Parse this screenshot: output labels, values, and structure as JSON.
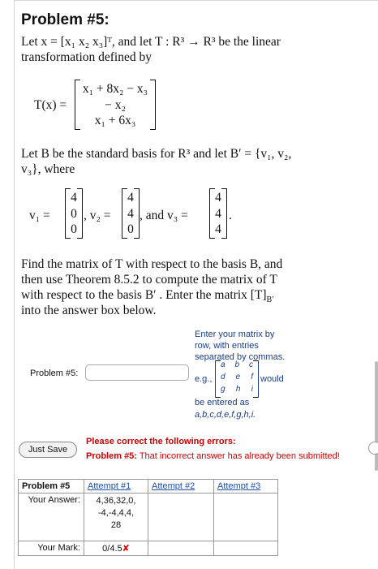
{
  "problem": {
    "title": "Problem #5:",
    "intro_a": "Let x = [x",
    "intro_text": "Let x = [x1 x2 x3]T, and let T: R3 → R3 be the linear transformation defined by",
    "line1": "Let x = [x₁  x₂  x₃]ᵀ, and let T : R³ → R³ be the linear",
    "line2": "transformation defined by",
    "tx_label": "T(x)  =",
    "tx_rows": [
      "x₁ + 8x₂ − x₃",
      "− x₂",
      "x₁ + 6x₃"
    ],
    "basis_line1": "Let B be the standard basis for R³ and let B′ = {v₁, v₂,",
    "basis_line2": "v₃}, where",
    "v1_label": "v₁  =",
    "v1": [
      "4",
      "0",
      "0"
    ],
    "v2_label": ",  v₂  =",
    "v2": [
      "4",
      "4",
      "0"
    ],
    "v3_label": ",  and  v₃  =",
    "v3": [
      "4",
      "4",
      "4"
    ],
    "find_lines": [
      "Find the matrix of T with respect to the basis B, and",
      "then use Theorem 8.5.2 to compute the matrix of T",
      "with respect to the basis B′ . Enter the matrix [T]",
      "into the answer box below."
    ],
    "sub_bprime": "B′"
  },
  "answer_area": {
    "label": "Problem #5:",
    "input_value": "",
    "hint_lines": [
      "Enter your matrix by",
      "row, with entries",
      "separated by commas."
    ],
    "eg_label": "e.g.,",
    "eg_matrix": [
      [
        "a",
        "b",
        "c"
      ],
      [
        "d",
        "e",
        "f"
      ],
      [
        "g",
        "h",
        "i"
      ]
    ],
    "would": "would",
    "be_entered": "be entered as",
    "example_entry": "a,b,c,d,e,f,g,h,i."
  },
  "actions": {
    "just_save": "Just Save"
  },
  "errors": {
    "heading": "Please correct the following errors:",
    "problem_label": "Problem #5:",
    "message": " That incorrect answer has already been submitted!"
  },
  "attempts": {
    "header": "Problem #5",
    "columns": [
      "Attempt #1",
      "Attempt #2",
      "Attempt #3"
    ],
    "your_answer_label": "Your Answer:",
    "answer_lines": [
      "4,36,32,0,",
      "-4,-4,4,4,",
      "28"
    ],
    "your_mark_label": "Your Mark:",
    "mark": "0/4.5",
    "mark_symbol": "✘"
  }
}
